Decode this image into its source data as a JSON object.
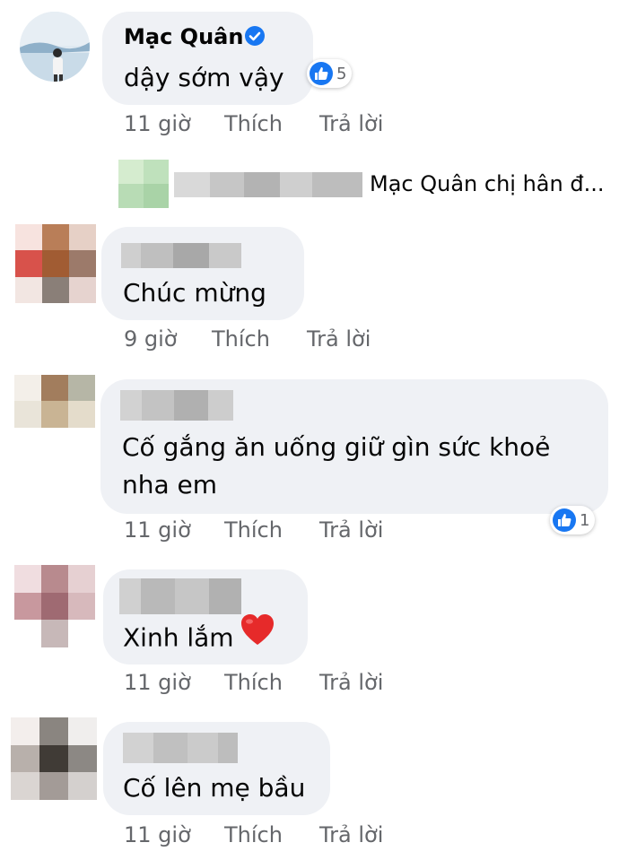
{
  "colors": {
    "bubble": "#eff1f5",
    "like_blue": "#1877f2",
    "meta_gray": "#65676b",
    "heart_red": "#e62a2a"
  },
  "comments": [
    {
      "author": "Mạc Quân",
      "verified": true,
      "text": "dậy sớm vậy",
      "reaction_icon": "like-icon",
      "reaction_count": "5",
      "time": "11 giờ",
      "like_label": "Thích",
      "reply_label": "Trả lời",
      "reply_preview": {
        "text": "Mạc Quân chị hân đ..."
      }
    },
    {
      "text": "Chúc mừng",
      "time": "9 giờ",
      "like_label": "Thích",
      "reply_label": "Trả lời"
    },
    {
      "text_line1": "Cố gắng ăn uống giữ gìn sức khoẻ",
      "text_line2": "nha em",
      "reaction_icon": "like-icon",
      "reaction_count": "1",
      "time": "11 giờ",
      "like_label": "Thích",
      "reply_label": "Trả lời"
    },
    {
      "text": "Xinh lắm",
      "emoji_icon": "red-heart-icon",
      "time": "11 giờ",
      "like_label": "Thích",
      "reply_label": "Trả lời"
    },
    {
      "text": "Cố lên mẹ bầu",
      "time": "11 giờ",
      "like_label": "Thích",
      "reply_label": "Trả lời"
    }
  ]
}
